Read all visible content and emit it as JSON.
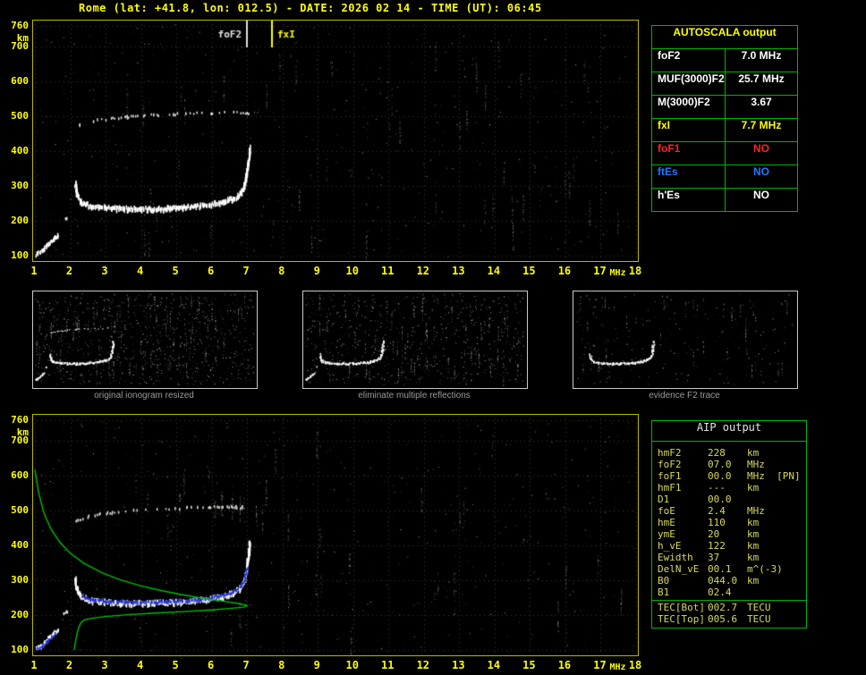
{
  "title": "Rome (lat: +41.8, lon: 012.5) - DATE: 2026 02 14 - TIME (UT): 06:45",
  "colors": {
    "background": "#000000",
    "title": "#ffff00",
    "axis_labels": "#ffff00",
    "plot_border": "#b8b800",
    "grid": "#3c3c26",
    "table_border": "#00b400",
    "trace_white": "#ffffff",
    "profile_green": "#00c000",
    "fit_blue": "#2233dd",
    "autoscala_header": "#ffff00",
    "aip_text": "#d8d85c"
  },
  "autoscala_table": {
    "header": "AUTOSCALA output",
    "rows": [
      {
        "label": "foF2",
        "value": "7.0 MHz",
        "color": "#ffffff"
      },
      {
        "label": "MUF(3000)F2",
        "value": "25.7 MHz",
        "color": "#ffffff"
      },
      {
        "label": "M(3000)F2",
        "value": "3.67",
        "color": "#ffffff"
      },
      {
        "label": "fxI",
        "value": "7.7 MHz",
        "color": "#ffff00"
      },
      {
        "label": "foF1",
        "value": "NO",
        "color": "#ff2222"
      },
      {
        "label": "ftEs",
        "value": "NO",
        "color": "#2277ff"
      },
      {
        "label": "h'Es",
        "value": "NO",
        "color": "#ffffff"
      }
    ]
  },
  "aip_table": {
    "header": "AIP output",
    "rows": [
      {
        "name": "hmF2",
        "value": "228",
        "unit": "km"
      },
      {
        "name": "foF2",
        "value": "07.0",
        "unit": "MHz"
      },
      {
        "name": "foF1",
        "value": "00.0",
        "unit": "MHz  [PN]"
      },
      {
        "name": "hmF1",
        "value": "---",
        "unit": "km"
      },
      {
        "name": "D1",
        "value": "00.0",
        "unit": ""
      },
      {
        "name": "foE",
        "value": "2.4",
        "unit": "MHz"
      },
      {
        "name": "hmE",
        "value": "110",
        "unit": "km"
      },
      {
        "name": "ymE",
        "value": "20",
        "unit": "km"
      },
      {
        "name": "h_vE",
        "value": "122",
        "unit": "km"
      },
      {
        "name": "Ewidth",
        "value": "37",
        "unit": "km"
      },
      {
        "name": "DelN_vE",
        "value": "00.1",
        "unit": "m^(-3)"
      },
      {
        "name": "B0",
        "value": "044.0",
        "unit": "km"
      },
      {
        "name": "B1",
        "value": "02.4",
        "unit": ""
      },
      {
        "name": "TEC[Bot]",
        "value": "002.7",
        "unit": "TECU",
        "separated": true
      },
      {
        "name": "TEC[Top]",
        "value": "005.6",
        "unit": "TECU"
      }
    ]
  },
  "thumbnails": [
    {
      "caption": "original ionogram resized",
      "noise": 1250,
      "streaks": 70,
      "series": [
        0,
        1,
        2,
        3
      ],
      "seed": 21
    },
    {
      "caption": "eliminate multiple reflections",
      "noise": 1000,
      "streaks": 60,
      "series": [
        1,
        2,
        3
      ],
      "seed": 22
    },
    {
      "caption": "evidence F2 trace",
      "noise": 330,
      "streaks": 28,
      "series": [
        3
      ],
      "seed": 23
    }
  ],
  "chart_data": [
    {
      "type": "scatter",
      "title": "recorded ionogram with autoscaled characteristics",
      "xlabel": "MHz",
      "ylabel": "km",
      "xlim": [
        1,
        18
      ],
      "ylim": [
        100,
        760
      ],
      "x_ticks": [
        1,
        2,
        3,
        4,
        5,
        6,
        7,
        8,
        9,
        10,
        11,
        12,
        13,
        14,
        15,
        16,
        17,
        18
      ],
      "y_ticks": [
        760,
        700,
        600,
        500,
        400,
        300,
        200,
        100
      ],
      "grid": true,
      "legend": false,
      "markers": [
        {
          "label": "foF2",
          "x": 7.0,
          "color": "#e0e0e0",
          "align": "left"
        },
        {
          "label": "fxI",
          "x": 7.7,
          "color": "#ffff00",
          "align": "right"
        }
      ],
      "series": [
        {
          "name": "second-hop F2 echo",
          "color": "#d8d8d8",
          "thickness": 3,
          "density": 0.28,
          "points": [
            [
              2.1,
              468
            ],
            [
              2.4,
              480
            ],
            [
              2.8,
              489
            ],
            [
              3.2,
              494
            ],
            [
              3.7,
              499
            ],
            [
              4.2,
              503
            ],
            [
              4.8,
              506
            ],
            [
              5.4,
              508
            ],
            [
              6.0,
              509
            ],
            [
              6.6,
              510
            ],
            [
              7.1,
              510
            ]
          ]
        },
        {
          "name": "low-altitude echoes",
          "color": "#ffffff",
          "thickness": 4,
          "density": 0.85,
          "points": [
            [
              1.02,
              102
            ],
            [
              1.12,
              110
            ],
            [
              1.22,
              118
            ],
            [
              1.32,
              127
            ],
            [
              1.45,
              140
            ],
            [
              1.58,
              152
            ],
            [
              1.66,
              158
            ]
          ]
        },
        {
          "name": "isolated echoes",
          "color": "#e8e8e8",
          "thickness": 3,
          "density": 0.6,
          "points": [
            [
              1.82,
              203
            ],
            [
              1.9,
              210
            ]
          ]
        },
        {
          "name": "F2-layer trace",
          "color": "#ffffff",
          "thickness": 5,
          "density": 1,
          "points": [
            [
              2.12,
              305
            ],
            [
              2.18,
              272
            ],
            [
              2.3,
              252
            ],
            [
              2.6,
              241
            ],
            [
              3.0,
              236
            ],
            [
              3.6,
              233
            ],
            [
              4.2,
              233
            ],
            [
              4.8,
              235
            ],
            [
              5.4,
              239
            ],
            [
              5.9,
              245
            ],
            [
              6.3,
              253
            ],
            [
              6.6,
              263
            ],
            [
              6.8,
              277
            ],
            [
              6.92,
              300
            ],
            [
              6.98,
              335
            ],
            [
              7.03,
              375
            ],
            [
              7.06,
              410
            ]
          ]
        }
      ],
      "render": {
        "seed": 11,
        "noise": 780,
        "streaks": 48
      }
    },
    {
      "type": "scatter",
      "title": "ionogram with fitted trace and electron density profile",
      "xlabel": "MHz",
      "ylabel": "km",
      "xlim": [
        1,
        18
      ],
      "ylim": [
        100,
        760
      ],
      "x_ticks": [
        1,
        2,
        3,
        4,
        5,
        6,
        7,
        8,
        9,
        10,
        11,
        12,
        13,
        14,
        15,
        16,
        17,
        18
      ],
      "y_ticks": [
        760,
        700,
        600,
        500,
        400,
        300,
        200,
        100
      ],
      "grid": true,
      "legend": false,
      "markers": [],
      "series": [
        {
          "name": "second-hop F2 echo",
          "color": "#d8d8d8",
          "thickness": 3,
          "density": 0.28,
          "points": [
            [
              2.1,
              468
            ],
            [
              2.4,
              480
            ],
            [
              2.8,
              489
            ],
            [
              3.2,
              494
            ],
            [
              3.7,
              499
            ],
            [
              4.2,
              503
            ],
            [
              4.8,
              506
            ],
            [
              5.4,
              508
            ],
            [
              6.0,
              509
            ],
            [
              6.6,
              510
            ],
            [
              7.1,
              510
            ]
          ]
        },
        {
          "name": "low-altitude echoes",
          "color": "#ffffff",
          "thickness": 4,
          "density": 0.85,
          "points": [
            [
              1.02,
              102
            ],
            [
              1.12,
              110
            ],
            [
              1.22,
              118
            ],
            [
              1.32,
              127
            ],
            [
              1.45,
              140
            ],
            [
              1.58,
              152
            ],
            [
              1.66,
              158
            ]
          ]
        },
        {
          "name": "isolated echoes",
          "color": "#e8e8e8",
          "thickness": 3,
          "density": 0.6,
          "points": [
            [
              1.82,
              203
            ],
            [
              1.9,
              210
            ]
          ]
        },
        {
          "name": "F2-layer trace",
          "color": "#ffffff",
          "thickness": 5,
          "density": 1,
          "points": [
            [
              2.12,
              305
            ],
            [
              2.18,
              272
            ],
            [
              2.3,
              252
            ],
            [
              2.6,
              241
            ],
            [
              3.0,
              236
            ],
            [
              3.6,
              233
            ],
            [
              4.2,
              233
            ],
            [
              4.8,
              235
            ],
            [
              5.4,
              239
            ],
            [
              5.9,
              245
            ],
            [
              6.3,
              253
            ],
            [
              6.6,
              263
            ],
            [
              6.8,
              277
            ],
            [
              6.92,
              300
            ],
            [
              6.98,
              335
            ],
            [
              7.03,
              375
            ],
            [
              7.06,
              410
            ]
          ]
        },
        {
          "name": "fitted F2 trace",
          "color": "#2233dd",
          "thickness": 3,
          "density": 0.95,
          "points": [
            [
              2.3,
              254
            ],
            [
              2.6,
              244
            ],
            [
              3.0,
              239
            ],
            [
              3.6,
              236
            ],
            [
              4.2,
              236
            ],
            [
              4.8,
              238
            ],
            [
              5.4,
              242
            ],
            [
              5.9,
              248
            ],
            [
              6.3,
              256
            ],
            [
              6.6,
              266
            ],
            [
              6.8,
              280
            ],
            [
              6.92,
              303
            ],
            [
              6.98,
              336
            ]
          ]
        },
        {
          "name": "fitted low echoes",
          "color": "#2233dd",
          "thickness": 3,
          "density": 0.8,
          "points": [
            [
              1.05,
              102
            ],
            [
              1.2,
              111
            ],
            [
              1.4,
              129
            ],
            [
              1.56,
              147
            ]
          ]
        },
        {
          "name": "electron density profile",
          "style": "line",
          "color": "#00c000",
          "points": [
            [
              1.0,
              618
            ],
            [
              1.1,
              555
            ],
            [
              1.25,
              495
            ],
            [
              1.45,
              448
            ],
            [
              1.7,
              410
            ],
            [
              2.0,
              378
            ],
            [
              2.4,
              348
            ],
            [
              2.9,
              322
            ],
            [
              3.4,
              302
            ],
            [
              4.0,
              284
            ],
            [
              4.6,
              270
            ],
            [
              5.2,
              258
            ],
            [
              5.8,
              248
            ],
            [
              6.4,
              239
            ],
            [
              6.8,
              233
            ],
            [
              7.0,
              228
            ],
            [
              6.9,
              223
            ],
            [
              6.5,
              219
            ],
            [
              6.0,
              215
            ],
            [
              5.2,
              210
            ],
            [
              4.4,
              206
            ],
            [
              3.6,
              201
            ],
            [
              3.0,
              196
            ],
            [
              2.6,
              191
            ],
            [
              2.4,
              186
            ],
            [
              2.3,
              178
            ],
            [
              2.24,
              165
            ],
            [
              2.2,
              150
            ],
            [
              2.16,
              130
            ],
            [
              2.13,
              112
            ],
            [
              2.11,
              100
            ]
          ]
        }
      ],
      "render": {
        "seed": 12,
        "noise": 760,
        "streaks": 44
      }
    }
  ]
}
